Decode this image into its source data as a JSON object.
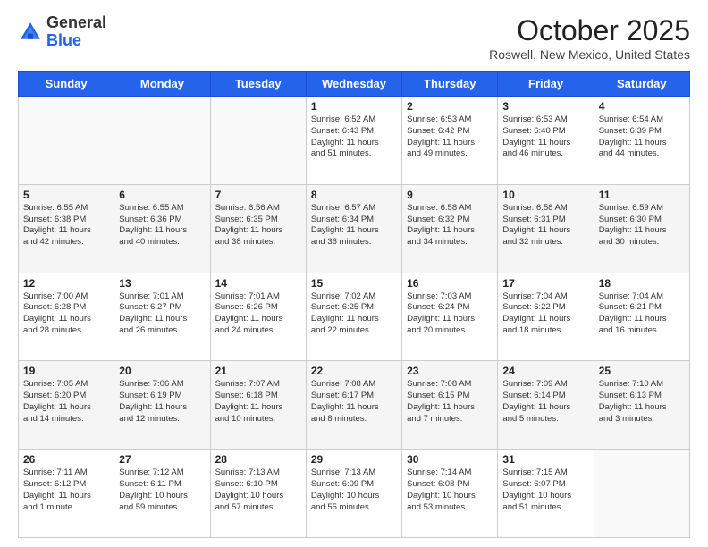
{
  "header": {
    "logo": {
      "general": "General",
      "blue": "Blue"
    },
    "title": "October 2025",
    "location": "Roswell, New Mexico, United States"
  },
  "days_of_week": [
    "Sunday",
    "Monday",
    "Tuesday",
    "Wednesday",
    "Thursday",
    "Friday",
    "Saturday"
  ],
  "weeks": [
    [
      {
        "day": "",
        "text": ""
      },
      {
        "day": "",
        "text": ""
      },
      {
        "day": "",
        "text": ""
      },
      {
        "day": "1",
        "text": "Sunrise: 6:52 AM\nSunset: 6:43 PM\nDaylight: 11 hours\nand 51 minutes."
      },
      {
        "day": "2",
        "text": "Sunrise: 6:53 AM\nSunset: 6:42 PM\nDaylight: 11 hours\nand 49 minutes."
      },
      {
        "day": "3",
        "text": "Sunrise: 6:53 AM\nSunset: 6:40 PM\nDaylight: 11 hours\nand 46 minutes."
      },
      {
        "day": "4",
        "text": "Sunrise: 6:54 AM\nSunset: 6:39 PM\nDaylight: 11 hours\nand 44 minutes."
      }
    ],
    [
      {
        "day": "5",
        "text": "Sunrise: 6:55 AM\nSunset: 6:38 PM\nDaylight: 11 hours\nand 42 minutes."
      },
      {
        "day": "6",
        "text": "Sunrise: 6:55 AM\nSunset: 6:36 PM\nDaylight: 11 hours\nand 40 minutes."
      },
      {
        "day": "7",
        "text": "Sunrise: 6:56 AM\nSunset: 6:35 PM\nDaylight: 11 hours\nand 38 minutes."
      },
      {
        "day": "8",
        "text": "Sunrise: 6:57 AM\nSunset: 6:34 PM\nDaylight: 11 hours\nand 36 minutes."
      },
      {
        "day": "9",
        "text": "Sunrise: 6:58 AM\nSunset: 6:32 PM\nDaylight: 11 hours\nand 34 minutes."
      },
      {
        "day": "10",
        "text": "Sunrise: 6:58 AM\nSunset: 6:31 PM\nDaylight: 11 hours\nand 32 minutes."
      },
      {
        "day": "11",
        "text": "Sunrise: 6:59 AM\nSunset: 6:30 PM\nDaylight: 11 hours\nand 30 minutes."
      }
    ],
    [
      {
        "day": "12",
        "text": "Sunrise: 7:00 AM\nSunset: 6:28 PM\nDaylight: 11 hours\nand 28 minutes."
      },
      {
        "day": "13",
        "text": "Sunrise: 7:01 AM\nSunset: 6:27 PM\nDaylight: 11 hours\nand 26 minutes."
      },
      {
        "day": "14",
        "text": "Sunrise: 7:01 AM\nSunset: 6:26 PM\nDaylight: 11 hours\nand 24 minutes."
      },
      {
        "day": "15",
        "text": "Sunrise: 7:02 AM\nSunset: 6:25 PM\nDaylight: 11 hours\nand 22 minutes."
      },
      {
        "day": "16",
        "text": "Sunrise: 7:03 AM\nSunset: 6:24 PM\nDaylight: 11 hours\nand 20 minutes."
      },
      {
        "day": "17",
        "text": "Sunrise: 7:04 AM\nSunset: 6:22 PM\nDaylight: 11 hours\nand 18 minutes."
      },
      {
        "day": "18",
        "text": "Sunrise: 7:04 AM\nSunset: 6:21 PM\nDaylight: 11 hours\nand 16 minutes."
      }
    ],
    [
      {
        "day": "19",
        "text": "Sunrise: 7:05 AM\nSunset: 6:20 PM\nDaylight: 11 hours\nand 14 minutes."
      },
      {
        "day": "20",
        "text": "Sunrise: 7:06 AM\nSunset: 6:19 PM\nDaylight: 11 hours\nand 12 minutes."
      },
      {
        "day": "21",
        "text": "Sunrise: 7:07 AM\nSunset: 6:18 PM\nDaylight: 11 hours\nand 10 minutes."
      },
      {
        "day": "22",
        "text": "Sunrise: 7:08 AM\nSunset: 6:17 PM\nDaylight: 11 hours\nand 8 minutes."
      },
      {
        "day": "23",
        "text": "Sunrise: 7:08 AM\nSunset: 6:15 PM\nDaylight: 11 hours\nand 7 minutes."
      },
      {
        "day": "24",
        "text": "Sunrise: 7:09 AM\nSunset: 6:14 PM\nDaylight: 11 hours\nand 5 minutes."
      },
      {
        "day": "25",
        "text": "Sunrise: 7:10 AM\nSunset: 6:13 PM\nDaylight: 11 hours\nand 3 minutes."
      }
    ],
    [
      {
        "day": "26",
        "text": "Sunrise: 7:11 AM\nSunset: 6:12 PM\nDaylight: 11 hours\nand 1 minute."
      },
      {
        "day": "27",
        "text": "Sunrise: 7:12 AM\nSunset: 6:11 PM\nDaylight: 10 hours\nand 59 minutes."
      },
      {
        "day": "28",
        "text": "Sunrise: 7:13 AM\nSunset: 6:10 PM\nDaylight: 10 hours\nand 57 minutes."
      },
      {
        "day": "29",
        "text": "Sunrise: 7:13 AM\nSunset: 6:09 PM\nDaylight: 10 hours\nand 55 minutes."
      },
      {
        "day": "30",
        "text": "Sunrise: 7:14 AM\nSunset: 6:08 PM\nDaylight: 10 hours\nand 53 minutes."
      },
      {
        "day": "31",
        "text": "Sunrise: 7:15 AM\nSunset: 6:07 PM\nDaylight: 10 hours\nand 51 minutes."
      },
      {
        "day": "",
        "text": ""
      }
    ]
  ],
  "colors": {
    "header_bg": "#2563eb",
    "header_text": "#ffffff",
    "accent": "#2563eb"
  }
}
